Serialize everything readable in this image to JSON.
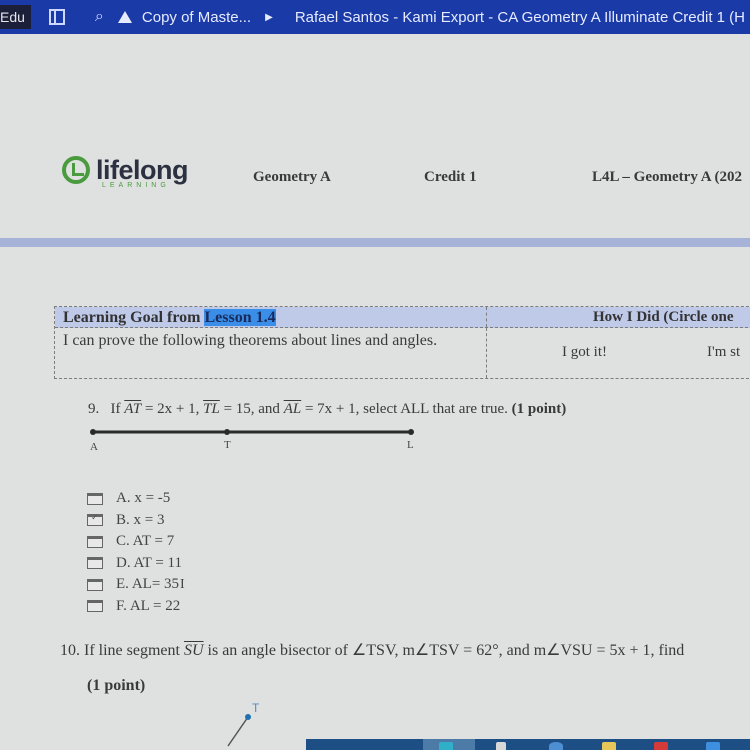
{
  "browser": {
    "profile_label": "Edu",
    "breadcrumb": "Copy of Maste...",
    "document_title": "Rafael Santos - Kami Export - CA Geometry A Illuminate Credit 1 (H",
    "icons": [
      "sidebar-toggle-icon",
      "search-icon",
      "google-drive-icon",
      "chevron-right-icon"
    ]
  },
  "header": {
    "logo_text": "lifelong",
    "logo_subtext": "LEARNING",
    "course": "Geometry A",
    "credit": "Credit 1",
    "course_code": "L4L – Geometry A (202"
  },
  "learning_goal": {
    "header_prefix": "Learning Goal from ",
    "header_highlight": "Lesson 1.4",
    "how_i_did": "How I Did (Circle one",
    "goal_text": "I can prove the following theorems about lines and angles.",
    "rating_options": [
      "I got it!",
      "I'm st"
    ]
  },
  "question9": {
    "number": "9.",
    "text_if": "If",
    "seg1": "AT",
    "eq1": " = 2x + 1, ",
    "seg2": "TL",
    "eq2": " = 15, and ",
    "seg3": "AL",
    "eq3": " = 7x + 1, select ALL that are true. ",
    "points": "(1 point)",
    "points_labels": [
      "A",
      "T",
      "L"
    ],
    "options": [
      {
        "label": "A. x = -5",
        "checked": false
      },
      {
        "label": "B. x = 3",
        "checked": true
      },
      {
        "label": "C. AT = 7",
        "checked": false
      },
      {
        "label": "D. AT = 11",
        "checked": false
      },
      {
        "label": "E. AL= 35",
        "checked": false
      },
      {
        "label": "F. AL = 22",
        "checked": false
      }
    ]
  },
  "question10": {
    "prefix": "10. If line segment ",
    "seg": "SU",
    "rest": " is an angle bisector of ∠TSV, m∠TSV = 62°, and m∠VSU = 5x + 1, find",
    "points": "(1 point)",
    "point_label": "T"
  },
  "colors": {
    "topbar": "#1a3aa8",
    "logo_green": "#4a9a3e",
    "table_header": "#bfc9e8",
    "highlight": "#3a8ee8",
    "taskbar": "#1e4f84"
  }
}
